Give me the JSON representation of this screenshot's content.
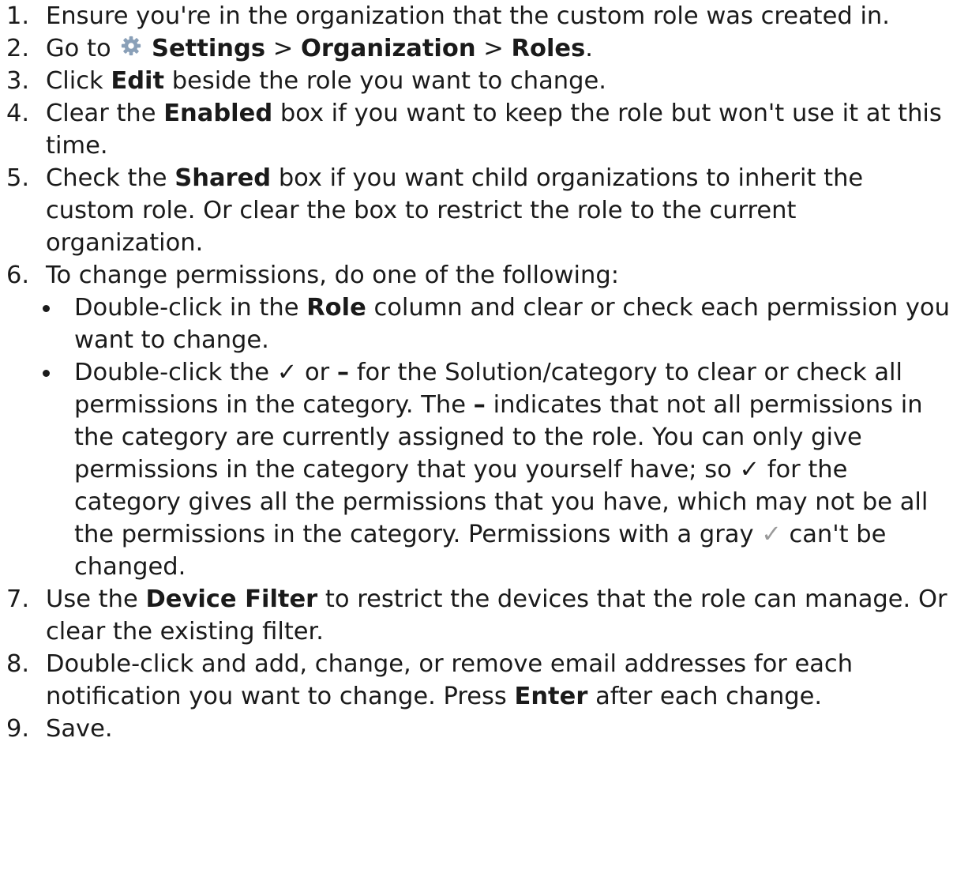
{
  "steps": [
    {
      "num": "1.",
      "text": "Ensure you're in the organization that the custom role was created in."
    },
    {
      "num": "2.",
      "a": "Go to",
      "icon": "gear-icon",
      "settings": "Settings",
      "sep1": ">",
      "organization": "Organization",
      "sep2": ">",
      "roles": "Roles",
      "end": "."
    },
    {
      "num": "3.",
      "a": "Click",
      "b": "Edit",
      "c": "beside the role you want to change."
    },
    {
      "num": "4.",
      "a": "Clear the",
      "b": "Enabled",
      "c": "box if you want to keep the role but won't use it at this time."
    },
    {
      "num": "5.",
      "a": "Check the",
      "b": "Shared",
      "c": "box if you want child organizations to inherit the custom role. Or clear the box to restrict the role to the current organization."
    },
    {
      "num": "6.",
      "text": "To change permissions, do one of the following:",
      "bullets": [
        {
          "a": "Double-click in the",
          "b": "Role",
          "c": "column and clear or check each permission you want to change."
        },
        {
          "a": "Double-click the",
          "check": "✓",
          "or": "or",
          "dash": "–",
          "c": "for the Solution/category to clear or check all permissions in the category. The",
          "dash2": "–",
          "d": "indicates that not all permissions in the category are currently assigned to the role. You can only give permissions in the category that you yourself have; so",
          "check2": "✓",
          "e": "for the category gives all the permissions that you have, which may not be all the permissions in the category. Permissions with a gray",
          "check3": "✓",
          "f": "can't be changed."
        }
      ]
    },
    {
      "num": "7.",
      "a": "Use the",
      "b": "Device Filter",
      "c": "to restrict the devices that the role can manage. Or clear the existing filter."
    },
    {
      "num": "8.",
      "a": "Double-click and add, change, or remove email addresses for each notification you want to change. Press",
      "b": "Enter",
      "c": "after each change."
    },
    {
      "num": "9.",
      "text": "Save."
    }
  ],
  "colors": {
    "text": "#1a1a1a",
    "gear": "#8aa0b8",
    "gray_check": "#9a9a9a"
  }
}
